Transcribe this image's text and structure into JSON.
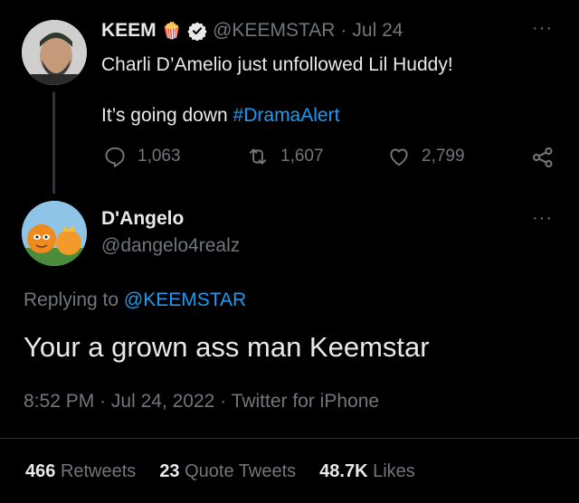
{
  "parent_tweet": {
    "display_name": "KEEM",
    "emoji": "🍿",
    "handle": "@KEEMSTAR",
    "separator": "·",
    "date": "Jul 24",
    "text_line1": "Charli D’Amelio just unfollowed Lil Huddy!",
    "text_line2_prefix": "It’s going down ",
    "hashtag": "#DramaAlert",
    "replies": "1,063",
    "retweets": "1,607",
    "likes": "2,799",
    "more": "···"
  },
  "reply_tweet": {
    "display_name": "D'Angelo",
    "handle": "@dangelo4realz",
    "more": "···",
    "replying_prefix": "Replying to ",
    "replying_to": "@KEEMSTAR",
    "text": "Your a grown ass man Keemstar",
    "time": "8:52 PM",
    "dot1": "·",
    "date": "Jul 24, 2022",
    "dot2": "·",
    "source": "Twitter for iPhone"
  },
  "engagement": {
    "retweets_count": "466",
    "retweets_label": "Retweets",
    "quotes_count": "23",
    "quotes_label": "Quote Tweets",
    "likes_count": "48.7K",
    "likes_label": "Likes"
  },
  "colors": {
    "background": "#000000",
    "text": "#e7e9ea",
    "muted": "#71767b",
    "accent": "#1d9bf0"
  }
}
